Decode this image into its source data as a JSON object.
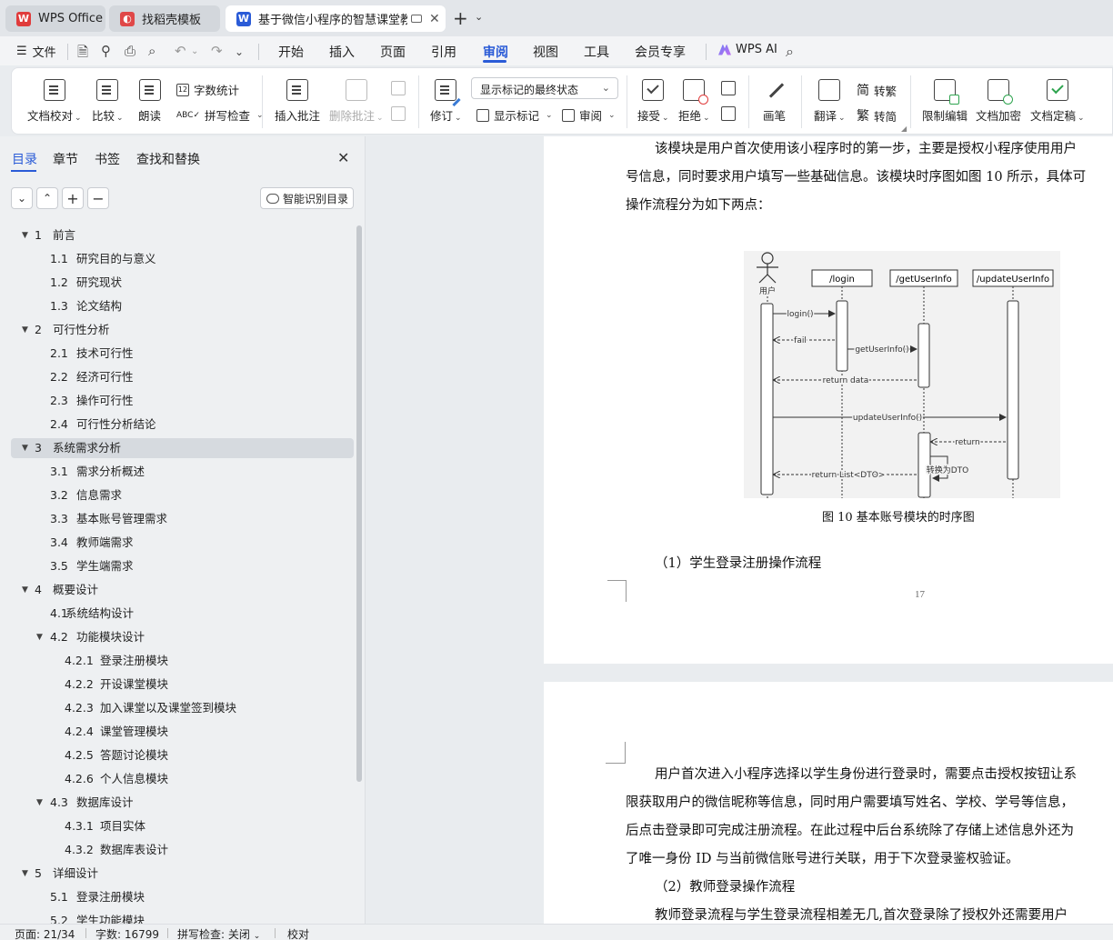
{
  "tabs": [
    {
      "label": "WPS Office",
      "logo": "W",
      "logo_color": "#e03b3b"
    },
    {
      "label": "找稻壳模板",
      "logo": "◐",
      "logo_color": "#e04848"
    },
    {
      "label": "基于微信小程序的智慧课堂教",
      "logo": "W",
      "logo_color": "#2a5bd7"
    }
  ],
  "menubar": {
    "file_label": "文件",
    "items": [
      "开始",
      "插入",
      "页面",
      "引用",
      "审阅",
      "视图",
      "工具",
      "会员专享"
    ],
    "active": "审阅",
    "ai_label": "WPS AI"
  },
  "ribbon": {
    "doc_check": "文档校对",
    "compare": "比较",
    "read_aloud": "朗读",
    "word_count": "字数统计",
    "spell_check": "拼写检查",
    "insert_comment": "插入批注",
    "delete_comment": "删除批注",
    "revise": "修订",
    "markup_select": "显示标记的最终状态",
    "show_markup": "显示标记",
    "review": "审阅",
    "accept": "接受",
    "reject": "拒绝",
    "pen": "画笔",
    "translate": "翻译",
    "to_traditional": "转繁",
    "to_simplified": "转简",
    "restrict_edit": "限制编辑",
    "encrypt": "文档加密",
    "finalize": "文档定稿"
  },
  "nav": {
    "tabs": [
      "目录",
      "章节",
      "书签",
      "查找和替换"
    ],
    "smart_toc": "智能识别目录",
    "toc": [
      {
        "num": "1",
        "title": "前言",
        "level": 1,
        "expand": true
      },
      {
        "num": "1.1",
        "title": "研究目的与意义",
        "level": 2
      },
      {
        "num": "1.2",
        "title": "研究现状",
        "level": 2
      },
      {
        "num": "1.3",
        "title": "论文结构",
        "level": 2
      },
      {
        "num": "2",
        "title": "可行性分析",
        "level": 1,
        "expand": true
      },
      {
        "num": "2.1",
        "title": "技术可行性",
        "level": 2
      },
      {
        "num": "2.2",
        "title": "经济可行性",
        "level": 2
      },
      {
        "num": "2.3",
        "title": "操作可行性",
        "level": 2
      },
      {
        "num": "2.4",
        "title": "可行性分析结论",
        "level": 2
      },
      {
        "num": "3",
        "title": "系统需求分析",
        "level": 1,
        "expand": true,
        "selected": true
      },
      {
        "num": "3.1",
        "title": "需求分析概述",
        "level": 2
      },
      {
        "num": "3.2",
        "title": "信息需求",
        "level": 2
      },
      {
        "num": "3.3",
        "title": "基本账号管理需求",
        "level": 2
      },
      {
        "num": "3.4",
        "title": "教师端需求",
        "level": 2
      },
      {
        "num": "3.5",
        "title": "学生端需求",
        "level": 2
      },
      {
        "num": "4",
        "title": "概要设计",
        "level": 1,
        "expand": true
      },
      {
        "num": "4.1",
        "title": "系统结构设计",
        "level": 2,
        "tight": true
      },
      {
        "num": "4.2",
        "title": "功能模块设计",
        "level": 2,
        "expand": true
      },
      {
        "num": "4.2.1",
        "title": "登录注册模块",
        "level": 3
      },
      {
        "num": "4.2.2",
        "title": "开设课堂模块",
        "level": 3
      },
      {
        "num": "4.2.3",
        "title": "加入课堂以及课堂签到模块",
        "level": 3
      },
      {
        "num": "4.2.4",
        "title": "课堂管理模块",
        "level": 3
      },
      {
        "num": "4.2.5",
        "title": "答题讨论模块",
        "level": 3
      },
      {
        "num": "4.2.6",
        "title": "个人信息模块",
        "level": 3
      },
      {
        "num": "4.3",
        "title": "数据库设计",
        "level": 2,
        "expand": true
      },
      {
        "num": "4.3.1",
        "title": "项目实体",
        "level": 3
      },
      {
        "num": "4.3.2",
        "title": "数据库表设计",
        "level": 3
      },
      {
        "num": "5",
        "title": "详细设计",
        "level": 1,
        "expand": true
      },
      {
        "num": "5.1",
        "title": "登录注册模块",
        "level": 2
      },
      {
        "num": "5.2",
        "title": "学生功能模块",
        "level": 2
      }
    ]
  },
  "doc": {
    "p1_lines": [
      "该模块是用户首次使用该小程序时的第一步，主要是授权小程序使用用户",
      "号信息，同时要求用户填写一些基础信息。该模块时序图如图 10 所示，具体可",
      "操作流程分为如下两点："
    ],
    "figure_caption": "图 10  基本账号模块的时序图",
    "heading1": "（1）学生登录注册操作流程",
    "page_number": "17",
    "p2_lines": [
      "用户首次进入小程序选择以学生身份进行登录时，需要点击授权按钮让系",
      "限获取用户的微信昵称等信息，同时用户需要填写姓名、学校、学号等信息，",
      "后点击登录即可完成注册流程。在此过程中后台系统除了存储上述信息外还为",
      "了唯一身份 ID 与当前微信账号进行关联，用于下次登录鉴权验证。"
    ],
    "heading2": "（2）教师登录操作流程",
    "p3_line": "教师登录流程与学生登录流程相差无几,首次登录除了授权外还需要用户"
  },
  "diagram": {
    "actor": "用户",
    "lifelines": [
      "/login",
      "/getUserInfo",
      "/updateUserInfo"
    ],
    "messages": [
      "login()",
      "fail",
      "getUserInfo()",
      "return data",
      "updateUserInfo()",
      "return",
      "转换为DTO",
      "return List<DTO>"
    ]
  },
  "status": {
    "page": "页面: 21/34",
    "words": "字数: 16799",
    "spell": "拼写检查: 关闭",
    "proof": "校对"
  }
}
